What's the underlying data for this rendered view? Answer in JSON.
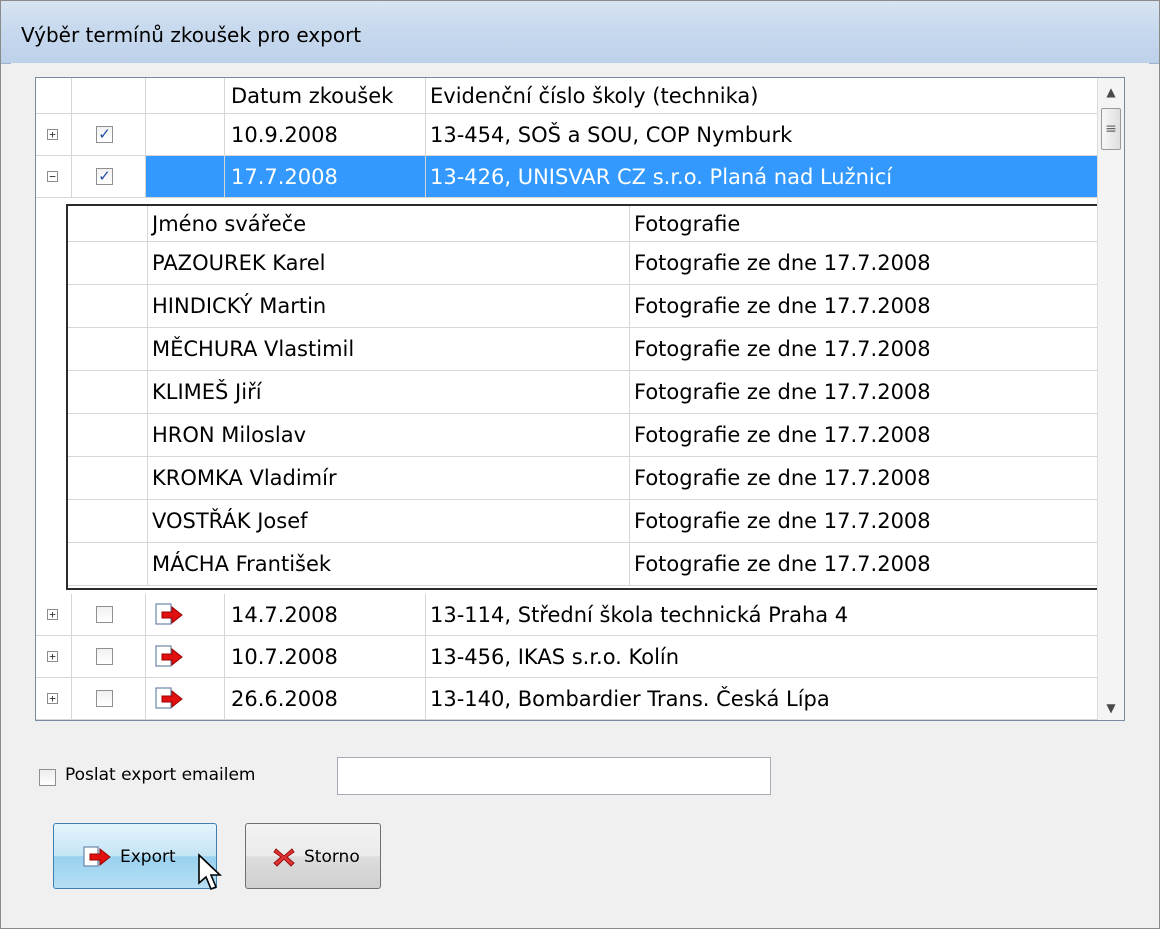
{
  "window": {
    "title": "Výběr termínů zkoušek pro export"
  },
  "grid": {
    "columns": [
      "",
      "",
      "",
      "Datum zkoušek",
      "Evidenční číslo školy (technika)"
    ],
    "rows": [
      {
        "expander": "+",
        "checked": true,
        "has_icon": false,
        "date": "10.9.2008",
        "school": "13-454, SOŠ a SOU, COP Nymburk",
        "selected": false
      },
      {
        "expander": "−",
        "checked": true,
        "has_icon": false,
        "date": "17.7.2008",
        "school": "13-426, UNISVAR CZ s.r.o. Planá nad Lužnicí",
        "selected": true
      },
      {
        "expander": "+",
        "checked": false,
        "has_icon": true,
        "date": "14.7.2008",
        "school": "13-114, Střední škola technická Praha 4",
        "selected": false
      },
      {
        "expander": "+",
        "checked": false,
        "has_icon": true,
        "date": "10.7.2008",
        "school": "13-456, IKAS s.r.o. Kolín",
        "selected": false
      },
      {
        "expander": "+",
        "checked": false,
        "has_icon": true,
        "date": "26.6.2008",
        "school": "13-140, Bombardier Trans. Česká Lípa",
        "selected": false
      }
    ],
    "child": {
      "columns": [
        "",
        "Jméno svářeče",
        "Fotografie"
      ],
      "rows": [
        {
          "name": "PAZOUREK Karel",
          "photo": "Fotografie ze dne 17.7.2008"
        },
        {
          "name": "HINDICKÝ Martin",
          "photo": "Fotografie ze dne 17.7.2008"
        },
        {
          "name": "MĚCHURA Vlastimil",
          "photo": "Fotografie ze dne 17.7.2008"
        },
        {
          "name": "KLIMEŠ Jiří",
          "photo": "Fotografie ze dne 17.7.2008"
        },
        {
          "name": "HRON Miloslav",
          "photo": "Fotografie ze dne 17.7.2008"
        },
        {
          "name": "KROMKA Vladimír",
          "photo": "Fotografie ze dne 17.7.2008"
        },
        {
          "name": "VOSTŘÁK Josef",
          "photo": "Fotografie ze dne 17.7.2008"
        },
        {
          "name": "MÁCHA František",
          "photo": "Fotografie ze dne 17.7.2008"
        }
      ]
    }
  },
  "email": {
    "label": "Poslat export emailem",
    "checked": false,
    "value": ""
  },
  "buttons": {
    "export_label": "Export",
    "storno_label": "Storno"
  },
  "colors": {
    "selection": "#3399ff",
    "export_arrow": "#e01010"
  },
  "icons": {
    "row_icon": "export-arrow-icon",
    "storno_icon": "red-x-icon"
  }
}
